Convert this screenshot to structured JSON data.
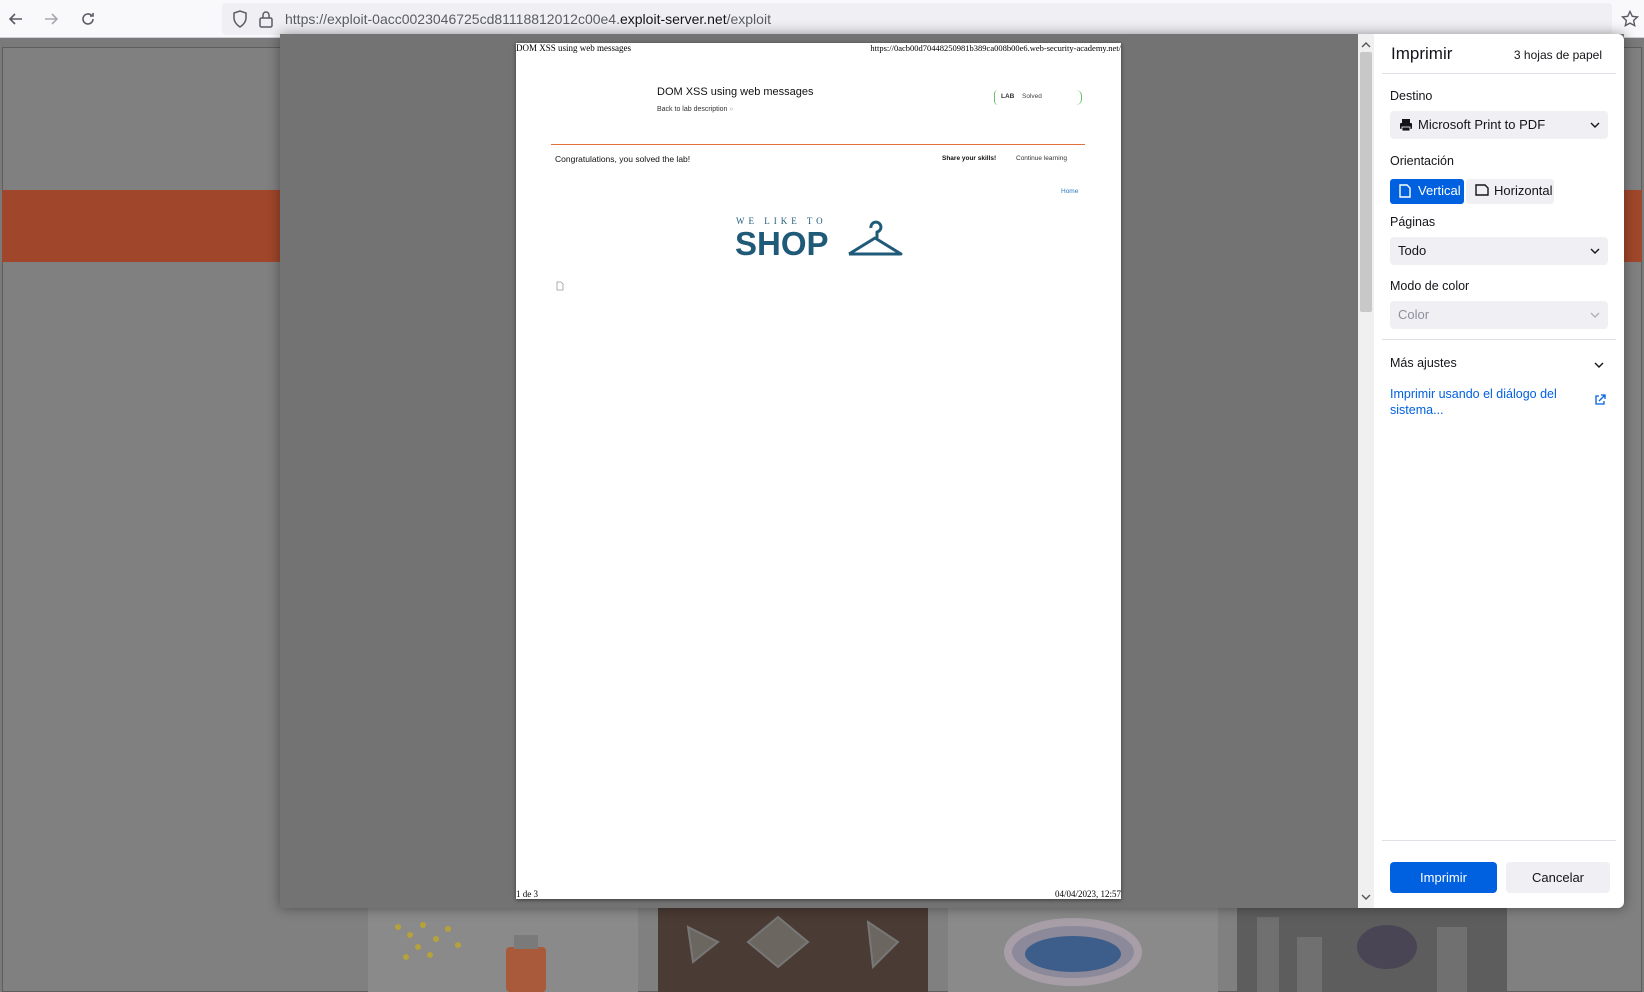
{
  "browser": {
    "url_prefix": "https://exploit-0acc0023046725cd81118812012c00e4.",
    "url_domain": "exploit-server.net",
    "url_path": "/exploit"
  },
  "print_dialog": {
    "title": "Imprimir",
    "sheets": "3 hojas de papel",
    "destination_label": "Destino",
    "destination_value": "Microsoft Print to PDF",
    "orientation_label": "Orientación",
    "orientation_vertical": "Vertical",
    "orientation_horizontal": "Horizontal",
    "pages_label": "Páginas",
    "pages_value": "Todo",
    "color_label": "Modo de color",
    "color_value": "Color",
    "more_settings": "Más ajustes",
    "system_dialog_link": "Imprimir usando el diálogo del sistema...",
    "print_button": "Imprimir",
    "cancel_button": "Cancelar"
  },
  "preview": {
    "header_left": "DOM XSS using web messages",
    "header_right": "https://0acb00d70448250981b389ca008b00e6.web-security-academy.net/",
    "lab_title": "DOM XSS using web messages",
    "back_link": "Back to lab description",
    "lab_badge": "LAB",
    "lab_status": "Solved",
    "congrats": "Congratulations, you solved the lab!",
    "share": "Share your skills!",
    "continue": "Continue learning",
    "home": "Home",
    "logo_top": "WE LIKE TO",
    "logo_main": "SHOP",
    "footer_left": "1 de 3",
    "footer_right": "04/04/2023, 12:57"
  }
}
